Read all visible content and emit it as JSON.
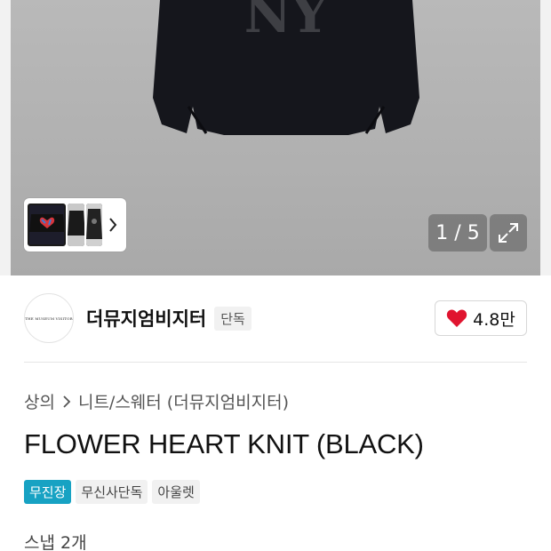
{
  "gallery": {
    "counter": "1 / 5",
    "sweater_text": "NY"
  },
  "brand": {
    "logo_text": "THE MUSEUM VISITOR",
    "name": "더뮤지엄비지터",
    "badge": "단독",
    "likes": "4.8만"
  },
  "breadcrumb": {
    "category": "상의",
    "subcategory": "니트/스웨터 (더뮤지엄비지터)"
  },
  "product": {
    "title": "FLOWER HEART KNIT (BLACK)",
    "tags": [
      "무진장",
      "무신사단독",
      "아울렛"
    ],
    "snap": "스냅 2개"
  },
  "colors": {
    "accent": "#17a2c3",
    "heart": "#e0142f"
  },
  "icons": {
    "thumb_next": "chevron-right-icon",
    "expand": "expand-icon",
    "like": "heart-icon",
    "breadcrumb_sep": "chevron-right-icon"
  }
}
